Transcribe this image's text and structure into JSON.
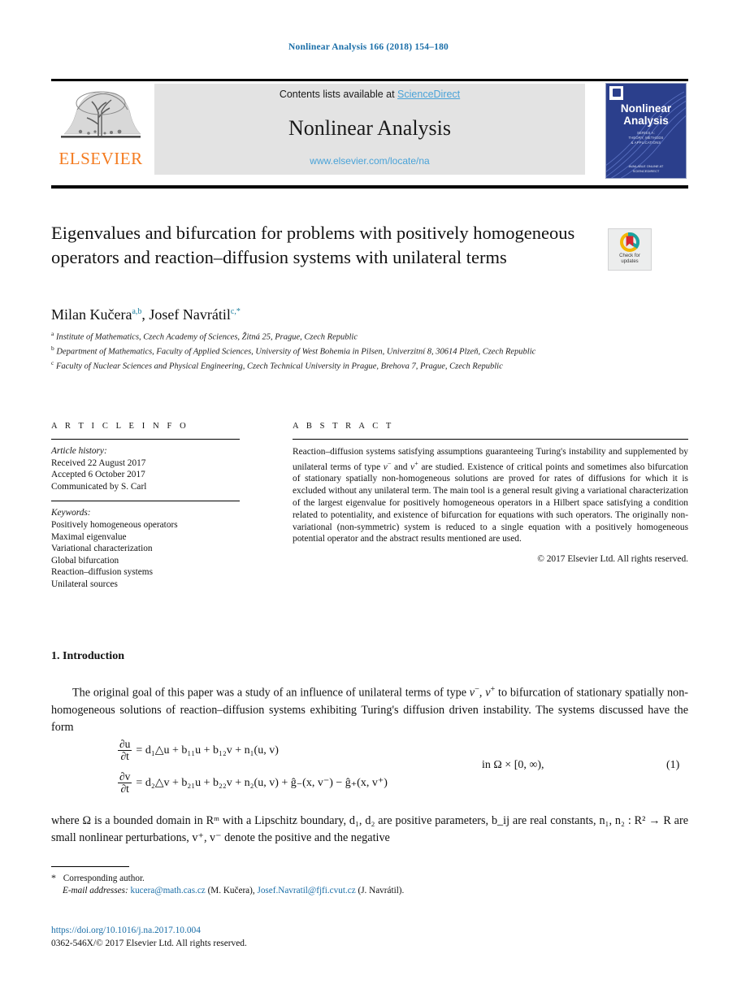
{
  "running_head": "Nonlinear Analysis 166 (2018) 154–180",
  "masthead": {
    "publisher_wordmark": "ELSEVIER",
    "contents_prefix": "Contents lists available at ",
    "sciencedirect": "ScienceDirect",
    "journal_title": "Nonlinear Analysis",
    "journal_url": "www.elsevier.com/locate/na",
    "cover": {
      "title_line1": "Nonlinear",
      "title_line2": "Analysis",
      "subtitle": "SERIES A:  THEORY, METHODS &amp; APPLICATIONS",
      "footer": "AVAILABLE ONLINE AT\nSCIENCEDIRECT"
    }
  },
  "article": {
    "title": "Eigenvalues and bifurcation for problems with positively homogeneous operators and reaction–diffusion systems with unilateral terms",
    "authors_plain": "Milan Kučera, Josef Navrátil",
    "author1": "Milan Kučera",
    "author1_sup": "a,b",
    "author2": "Josef Navrátil",
    "author2_sup": "c,*",
    "affiliations": [
      {
        "marker": "a",
        "text": "Institute of Mathematics, Czech Academy of Sciences, Žitná 25, Prague, Czech Republic"
      },
      {
        "marker": "b",
        "text": "Department of Mathematics, Faculty of Applied Sciences, University of West Bohemia in Pilsen, Univerzitní 8, 30614 Plzeň, Czech Republic"
      },
      {
        "marker": "c",
        "text": "Faculty of Nuclear Sciences and Physical Engineering, Czech Technical University in Prague, Brehova 7, Prague, Czech Republic"
      }
    ]
  },
  "crossmark": {
    "line1": "Check for",
    "line2": "updates"
  },
  "info": {
    "heading": "A R T I C L E  I N F O",
    "history_label": "Article history:",
    "history": [
      "Received 22 August 2017",
      "Accepted 6 October 2017",
      "Communicated by S. Carl"
    ],
    "keywords_label": "Keywords:",
    "keywords": [
      "Positively homogeneous operators",
      "Maximal eigenvalue",
      "Variational characterization",
      "Global bifurcation",
      "Reaction–diffusion systems",
      "Unilateral sources"
    ]
  },
  "abstract": {
    "heading": "A B S T R A C T",
    "text_part1": "Reaction–diffusion systems satisfying assumptions guaranteeing Turing's instability and supplemented by unilateral terms of type ",
    "text_part2": " and ",
    "text_part3": " are studied. Existence of critical points and sometimes also bifurcation of stationary spatially non-homogeneous solutions are proved for rates of diffusions for which it is excluded without any unilateral term. The main tool is a general result giving a variational characterization of the largest eigenvalue for positively homogeneous operators in a Hilbert space satisfying a condition related to potentiality, and existence of bifurcation for equations with such operators. The originally non-variational (non-symmetric) system is reduced to a single equation with a positively homogeneous potential operator and the abstract results mentioned are used.",
    "copyright": "© 2017 Elsevier Ltd. All rights reserved."
  },
  "section": {
    "heading": "1.  Introduction",
    "paragraph1_a": "The original goal of this paper was a study of an influence of unilateral terms of type ",
    "paragraph1_b": ", ",
    "paragraph1_c": " to bifurcation of stationary spatially non-homogeneous solutions of reaction–diffusion systems exhibiting Turing's diffusion driven instability. The systems discussed have the form",
    "paragraph2": "where Ω is a bounded domain in Rᵐ with a Lipschitz boundary, d₁, d₂ are positive parameters, b_ij are real constants, n₁, n₂ : R² → R are small nonlinear perturbations, v⁺, v⁻ denote the positive and the negative"
  },
  "equation": {
    "lhs1_num": "∂u",
    "lhs1_den": "∂t",
    "rhs1": "= d₁△u + b₁₁u + b₁₂v + n₁(u, v)",
    "lhs2_num": "∂v",
    "lhs2_den": "∂t",
    "rhs2": "= d₂△v + b₂₁u + b₂₂v + n₂(u, v) + ĝ₋(x, v⁻) − ĝ₊(x, v⁺)",
    "domain": "in Ω × [0, ∞),",
    "number": "(1)"
  },
  "footer": {
    "star": "*",
    "corresponding": "Corresponding author.",
    "email_label": "E-mail addresses:",
    "email1": "kucera@math.cas.cz",
    "email1_who": "(M. Kučera),",
    "email2": "Josef.Navratil@fjfi.cvut.cz",
    "email2_who": "(J. Navrátil).",
    "doi": "https://doi.org/10.1016/j.na.2017.10.004",
    "issn": "0362-546X/© 2017 Elsevier Ltd. All rights reserved."
  },
  "colors": {
    "link": "#1a6ea8",
    "sciencedirect": "#4aa3d8",
    "elsevier_orange": "#f47b20",
    "affil_sup": "#1c7f9e",
    "band_gray": "#e3e3e3",
    "cover_blue": "#2b3f8c"
  }
}
